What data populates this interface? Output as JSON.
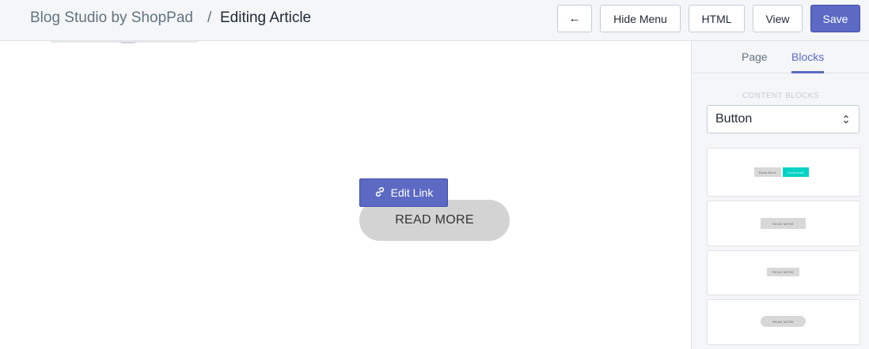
{
  "header": {
    "app_name": "Blog Studio by ShopPad",
    "separator": "/",
    "page_title": "Editing Article",
    "buttons": {
      "back_icon": "←",
      "hide_menu": "Hide Menu",
      "html": "HTML",
      "view": "View",
      "save": "Save"
    }
  },
  "canvas": {
    "edit_link_label": "Edit Link",
    "button_label": "READ MORE"
  },
  "sidebar": {
    "tabs": [
      {
        "label": "Page",
        "active": false
      },
      {
        "label": "Blocks",
        "active": true
      }
    ],
    "section_label": "CONTENT BLOCKS",
    "select_value": "Button",
    "blocks": [
      {
        "labels": [
          "Read More",
          "Download"
        ]
      },
      {
        "labels": [
          "READ MORE"
        ]
      },
      {
        "labels": [
          "READ MORE"
        ]
      },
      {
        "labels": [
          "READ MORE"
        ]
      }
    ]
  },
  "colors": {
    "accent": "#5c6ac4",
    "teal": "#00d2c4",
    "gray_button": "#d3d3d3"
  }
}
